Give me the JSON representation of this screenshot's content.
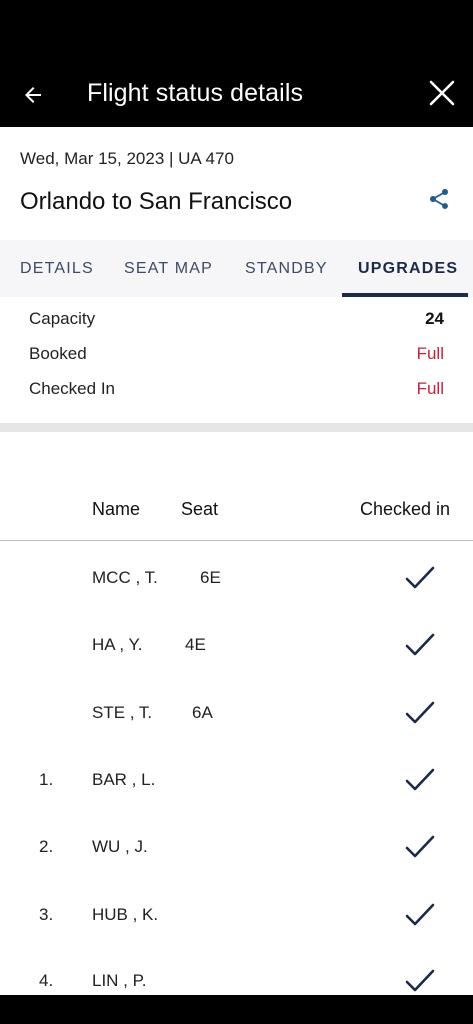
{
  "app_bar": {
    "title": "Flight status details",
    "back_icon": "arrow-back-icon",
    "close_icon": "close-icon"
  },
  "flight": {
    "date_line": "Wed, Mar 15, 2023 | UA 470",
    "route": "Orlando to San Francisco",
    "share_icon": "share-icon"
  },
  "tabs": [
    {
      "label": "DETAILS",
      "active": false
    },
    {
      "label": "SEAT MAP",
      "active": false
    },
    {
      "label": "STANDBY",
      "active": false
    },
    {
      "label": "UPGRADES",
      "active": true
    }
  ],
  "summary": [
    {
      "label": "Capacity",
      "value": "24"
    },
    {
      "label": "Booked",
      "value": "Full"
    },
    {
      "label": "Checked In",
      "value": "Full"
    }
  ],
  "list": {
    "headers": {
      "name": "Name",
      "seat": "Seat",
      "checked_in": "Checked in"
    },
    "rows": [
      {
        "num": "",
        "name": "MCC , T.",
        "seat": "6E",
        "checked_in": true
      },
      {
        "num": "",
        "name": "HA , Y.",
        "seat": "4E",
        "checked_in": true
      },
      {
        "num": "",
        "name": "STE , T.",
        "seat": "6A",
        "checked_in": true
      },
      {
        "num": "1.",
        "name": "BAR , L.",
        "seat": "",
        "checked_in": true
      },
      {
        "num": "2.",
        "name": "WU , J.",
        "seat": "",
        "checked_in": true
      },
      {
        "num": "3.",
        "name": "HUB , K.",
        "seat": "",
        "checked_in": true
      },
      {
        "num": "4.",
        "name": "LIN , P.",
        "seat": "",
        "checked_in": true
      }
    ]
  },
  "colors": {
    "accent": "#1b2a4a",
    "full_red": "#c4213a",
    "share_blue": "#1f5d8c"
  }
}
